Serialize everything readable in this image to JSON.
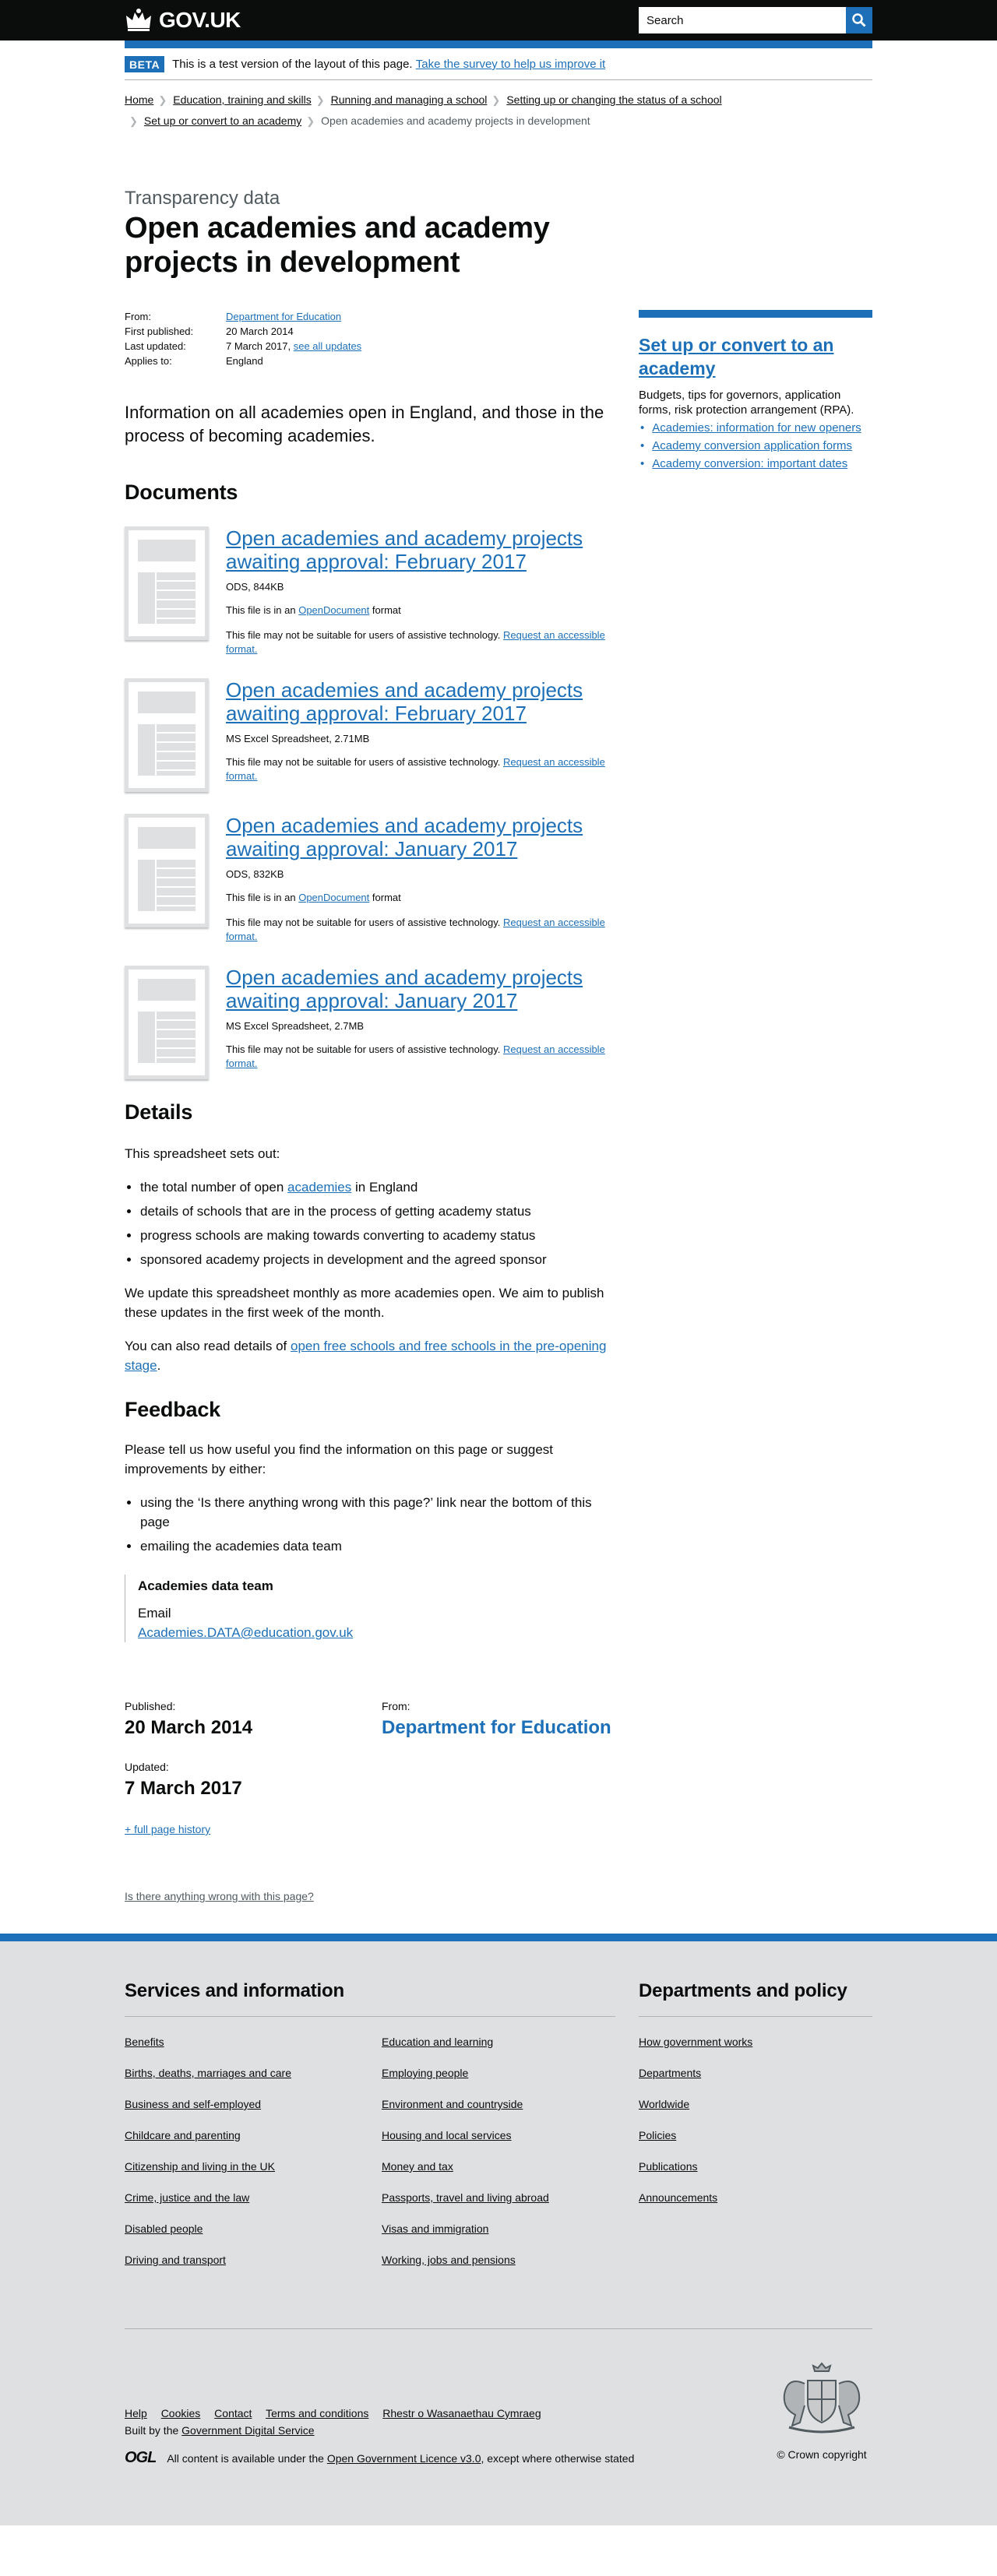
{
  "header": {
    "logo_text": "GOV.UK",
    "search_placeholder": "Search"
  },
  "beta": {
    "tag": "BETA",
    "text": "This is a test version of the layout of this page.",
    "link": "Take the survey to help us improve it"
  },
  "breadcrumbs": [
    "Home",
    "Education, training and skills",
    "Running and managing a school",
    "Setting up or changing the status of a school",
    "Set up or convert to an academy"
  ],
  "breadcrumb_current": "Open academies and academy projects in development",
  "page": {
    "context": "Transparency data",
    "title": "Open academies and academy projects in development"
  },
  "meta": {
    "from_label": "From:",
    "from_value": "Department for Education",
    "first_label": "First published:",
    "first_value": "20 March 2014",
    "last_label": "Last updated:",
    "last_value": "7 March 2017,",
    "last_link": "see all updates",
    "applies_label": "Applies to:",
    "applies_value": "England"
  },
  "lead": "Information on all academies open in England, and those in the process of becoming academies.",
  "documents": {
    "heading": "Documents",
    "items": [
      {
        "title": "Open academies and academy projects awaiting approval: February 2017",
        "size": "ODS, 844KB",
        "format_pre": "This file is in an",
        "format_link": "OpenDocument",
        "format_post": "format",
        "note": "This file may not be suitable for users of assistive technology.",
        "note_link": "Request an accessible format."
      },
      {
        "title": "Open academies and academy projects awaiting approval: February 2017",
        "size": "MS Excel Spreadsheet, 2.71MB",
        "note": "This file may not be suitable for users of assistive technology.",
        "note_link": "Request an accessible format."
      },
      {
        "title": "Open academies and academy projects awaiting approval: January 2017",
        "size": "ODS, 832KB",
        "format_pre": "This file is in an",
        "format_link": "OpenDocument",
        "format_post": "format",
        "note": "This file may not be suitable for users of assistive technology.",
        "note_link": "Request an accessible format."
      },
      {
        "title": "Open academies and academy projects awaiting approval: January 2017",
        "size": "MS Excel Spreadsheet, 2.7MB",
        "note": "This file may not be suitable for users of assistive technology.",
        "note_link": "Request an accessible format."
      }
    ]
  },
  "details": {
    "heading": "Details",
    "intro": "This spreadsheet sets out:",
    "bullet1_pre": "the total number of open",
    "bullet1_link": "academies",
    "bullet1_post": "in England",
    "bullet2": "details of schools that are in the process of getting academy status",
    "bullet3": "progress schools are making towards converting to academy status",
    "bullet4": "sponsored academy projects in development and the agreed sponsor",
    "para1": "We update this spreadsheet monthly as more academies open. We aim to publish these updates in the first week of the month.",
    "para2_pre": "You can also read details of",
    "para2_link": "open free schools and free schools in the pre-opening stage",
    "para2_post": "."
  },
  "feedback": {
    "heading": "Feedback",
    "intro": "Please tell us how useful you find the information on this page or suggest improvements by either:",
    "bullet1": "using the ‘Is there anything wrong with this page?’ link near the bottom of this page",
    "bullet2": "emailing the academies data team",
    "contact_name": "Academies data team",
    "contact_label": "Email",
    "contact_email": "Academies.DATA@education.gov.uk"
  },
  "publication": {
    "published_label": "Published:",
    "published_value": "20 March 2014",
    "from_label": "From:",
    "from_value": "Department for Education",
    "updated_label": "Updated:",
    "updated_value": "7 March 2017",
    "history_link": "+ full page history"
  },
  "report_link": "Is there anything wrong with this page?",
  "sidebar": {
    "title": "Set up or convert to an academy",
    "desc": "Budgets, tips for governors, application forms, risk protection arrangement (RPA).",
    "links": [
      "Academies: information for new openers",
      "Academy conversion application forms",
      "Academy conversion: important dates"
    ]
  },
  "footer": {
    "services_heading": "Services and information",
    "services": [
      "Benefits",
      "Births, deaths, marriages and care",
      "Business and self-employed",
      "Childcare and parenting",
      "Citizenship and living in the UK",
      "Crime, justice and the law",
      "Disabled people",
      "Driving and transport",
      "Education and learning",
      "Employing people",
      "Environment and countryside",
      "Housing and local services",
      "Money and tax",
      "Passports, travel and living abroad",
      "Visas and immigration",
      "Working, jobs and pensions"
    ],
    "departments_heading": "Departments and policy",
    "departments": [
      "How government works",
      "Departments",
      "Worldwide",
      "Policies",
      "Publications",
      "Announcements"
    ],
    "links": [
      "Help",
      "Cookies",
      "Contact",
      "Terms and conditions",
      "Rhestr o Wasanaethau Cymraeg"
    ],
    "built_pre": "Built by the",
    "built_link": "Government Digital Service",
    "ogl": "OGL",
    "licence_pre": "All content is available under the",
    "licence_link": "Open Government Licence v3.0",
    "licence_post": ", except where otherwise stated",
    "copyright": "© Crown copyright"
  },
  "colors": {
    "brand_blue": "#1d70b8",
    "header_black": "#0b0c0c",
    "footer_grey": "#dee0e2"
  }
}
